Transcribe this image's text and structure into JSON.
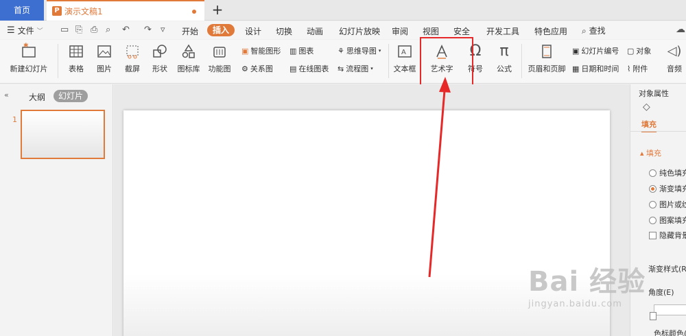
{
  "titlebar": {
    "home_tab": "首页",
    "doc_tab": "演示文稿1",
    "doc_icon_letter": "P",
    "new_tab": "+"
  },
  "menubar": {
    "file": "文件",
    "items": [
      "开始",
      "插入",
      "设计",
      "切换",
      "动画",
      "幻灯片放映",
      "审阅",
      "视图",
      "安全",
      "开发工具",
      "特色应用"
    ],
    "active": "插入",
    "search": "查找"
  },
  "ribbon": {
    "new_slide": "新建幻灯片",
    "table": "表格",
    "picture": "图片",
    "screenshot": "截屏",
    "shape": "形状",
    "icon_lib": "图标库",
    "func_chart": "功能图",
    "smart_art": "智能图形",
    "chart": "图表",
    "relation": "关系图",
    "online_chart": "在线图表",
    "mind_map": "思维导图",
    "flowchart": "流程图",
    "textbox": "文本框",
    "word_art": "艺术字",
    "symbol": "符号",
    "formula": "公式",
    "header_footer": "页眉和页脚",
    "slide_number": "幻灯片编号",
    "datetime": "日期和时间",
    "object": "对象",
    "attachment": "附件",
    "audio": "音频"
  },
  "leftpanel": {
    "outline_tab": "大纲",
    "slides_tab": "幻灯片",
    "slide_number": "1"
  },
  "rightpanel": {
    "title": "对象属性",
    "fill_tab": "填充",
    "section": "填充",
    "options": [
      {
        "label": "纯色填充",
        "selected": false
      },
      {
        "label": "渐变填充",
        "selected": true
      },
      {
        "label": "图片或纹理填充",
        "selected": false
      },
      {
        "label": "图案填充",
        "selected": false
      }
    ],
    "hide_bg": "隐藏背景图形",
    "gradient_style": "渐变样式(R)",
    "angle": "角度(E)",
    "color_stop": "色标颜色(C)"
  },
  "watermark": {
    "main": "Bai 经验",
    "sub": "jingyan.baidu.com"
  },
  "colors": {
    "accent": "#e07a3b",
    "home_tab": "#3d6fd1",
    "highlight": "#e62828"
  }
}
